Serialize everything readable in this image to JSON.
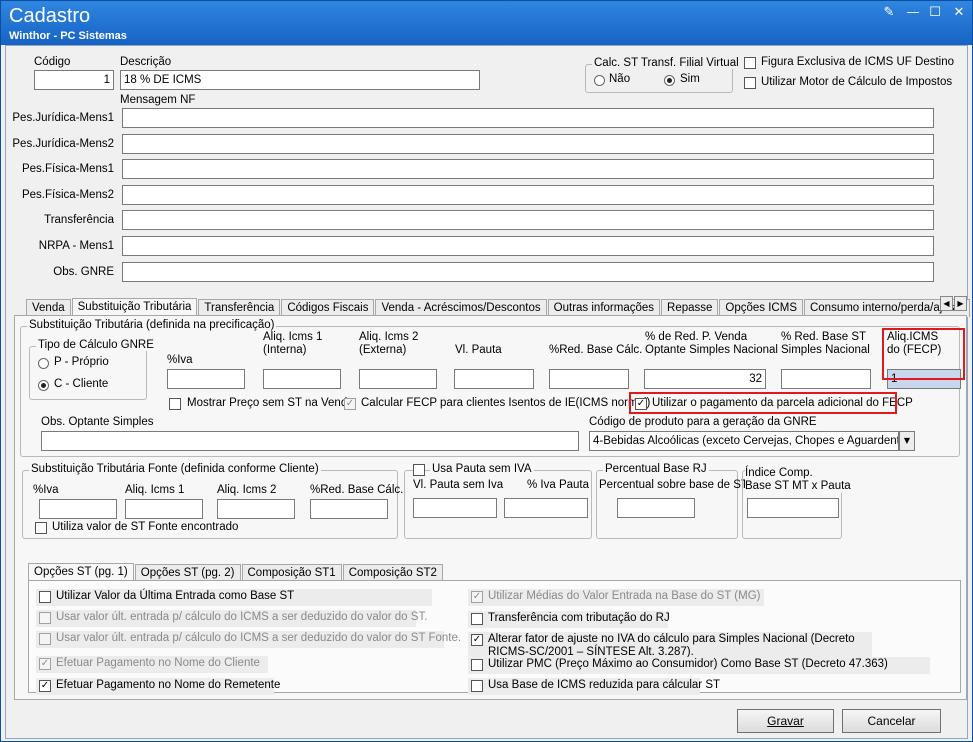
{
  "window": {
    "title": "Cadastro",
    "subtitle": "Winthor - PC Sistemas"
  },
  "header": {
    "codigo_label": "Código",
    "codigo_value": "1",
    "descricao_label": "Descrição",
    "descricao_value": "18 % DE ICMS",
    "mensagem_label": "Mensagem NF",
    "calc_st_label": "Calc. ST Transf. Filial Virtual",
    "nao_label": "Não",
    "sim_label": "Sim",
    "figura_label": "Figura Exclusiva de ICMS UF Destino",
    "motor_label": "Utilizar Motor de Cálculo de Impostos",
    "msg_rows": [
      {
        "label": "Pes.Jurídica-Mens1",
        "value": ""
      },
      {
        "label": "Pes.Jurídica-Mens2",
        "value": ""
      },
      {
        "label": "Pes.Física-Mens1",
        "value": ""
      },
      {
        "label": "Pes.Física-Mens2",
        "value": ""
      },
      {
        "label": "Transferência",
        "value": ""
      },
      {
        "label": "NRPA - Mens1",
        "value": ""
      },
      {
        "label": "Obs. GNRE",
        "value": ""
      }
    ]
  },
  "main_tabs": [
    "Venda",
    "Substituição Tributária",
    "Transferência",
    "Códigos Fiscais",
    "Venda - Acréscimos/Descontos",
    "Outras informações",
    "Repasse",
    "Opções ICMS",
    "Consumo interno/perda/ajuste"
  ],
  "st": {
    "group_title": "Substituição Tributária (definida na precificação)",
    "tipo_title": "Tipo de Cálculo GNRE",
    "p_proprio": "P - Próprio",
    "c_cliente": "C - Cliente",
    "iva_label": "%Iva",
    "iva_value": "",
    "aliq1_label": "Aliq. Icms 1\n(Interna)",
    "aliq1_value": "",
    "aliq2_label": "Aliq. Icms 2\n(Externa)",
    "aliq2_value": "",
    "vlpauta_label": "Vl. Pauta",
    "vlpauta_value": "",
    "redbase_label": "%Red. Base Cálc.",
    "redbase_value": "",
    "redp_label": "% de Red. P. Venda\nOptante Simples Nacional",
    "redp_value": "32",
    "redst_label": "% Red. Base ST\nSimples Nacional",
    "redst_value": "",
    "fecp_label": "Aliq.ICMS\ndo (FECP)",
    "fecp_value": "1",
    "mostrar_label": "Mostrar Preço sem ST na Venda",
    "calcfecp_label": "Calcular FECP para clientes Isentos de IE(ICMS normal)",
    "utilizar_fecp_label": "Utilizar o pagamento da parcela adicional do FECP",
    "obs_label": "Obs. Optante Simples",
    "obs_value": "",
    "codprod_label": "Código de produto para a geração da GNRE",
    "codprod_value": "4-Bebidas Alcoólicas (exceto Cervejas, Chopes e Aguardente)"
  },
  "fonte": {
    "title": "Substituição Tributária Fonte (definida conforme Cliente)",
    "iva": "%Iva",
    "aliq1": "Aliq. Icms 1",
    "aliq2": "Aliq. Icms 2",
    "redbase": "%Red. Base Cálc.",
    "utiliza": "Utiliza valor de ST Fonte encontrado"
  },
  "pauta": {
    "title": "Usa Pauta sem IVA",
    "vl": "Vl. Pauta sem Iva",
    "iva": "% Iva Pauta"
  },
  "rj": {
    "title": "Percentual Base RJ",
    "label": "Percentual sobre base de ST"
  },
  "indice": {
    "label": "Índice Comp.\nBase ST MT x Pauta"
  },
  "sub_tabs": [
    "Opções ST (pg. 1)",
    "Opções ST (pg. 2)",
    "Composição ST1",
    "Composição ST2"
  ],
  "opcoes_left": [
    {
      "label": "Utilizar Valor da Última Entrada como Base ST",
      "checked": false,
      "disabled": false
    },
    {
      "label": "Usar valor últ. entrada p/ cálculo do ICMS a ser deduzido do valor do ST.",
      "checked": false,
      "disabled": true
    },
    {
      "label": "Usar valor últ. entrada p/ cálculo do ICMS a ser deduzido do valor do ST Fonte.",
      "checked": false,
      "disabled": true
    },
    {
      "label": "Efetuar Pagamento no Nome do Cliente",
      "checked": true,
      "disabled": true
    },
    {
      "label": "Efetuar Pagamento no Nome do Remetente",
      "checked": true,
      "disabled": false
    }
  ],
  "opcoes_right": [
    {
      "label": "Utilizar Médias do Valor Entrada na Base do ST (MG)",
      "checked": true,
      "disabled": true
    },
    {
      "label": "Transferência com tributação do RJ",
      "checked": false,
      "disabled": false
    },
    {
      "label": "Alterar fator de ajuste no IVA do cálculo para Simples Nacional (Decreto\nRICMS-SC/2001 – SÍNTESE Alt. 3.287).",
      "checked": true,
      "disabled": false
    },
    {
      "label": "Utilizar PMC (Preço Máximo ao Consumidor) Como Base ST (Decreto 47.363)",
      "checked": false,
      "disabled": false
    },
    {
      "label": "Usa Base de ICMS reduzida para cálcular ST",
      "checked": false,
      "disabled": false
    }
  ],
  "buttons": {
    "gravar": "Gravar",
    "cancelar": "Cancelar"
  }
}
